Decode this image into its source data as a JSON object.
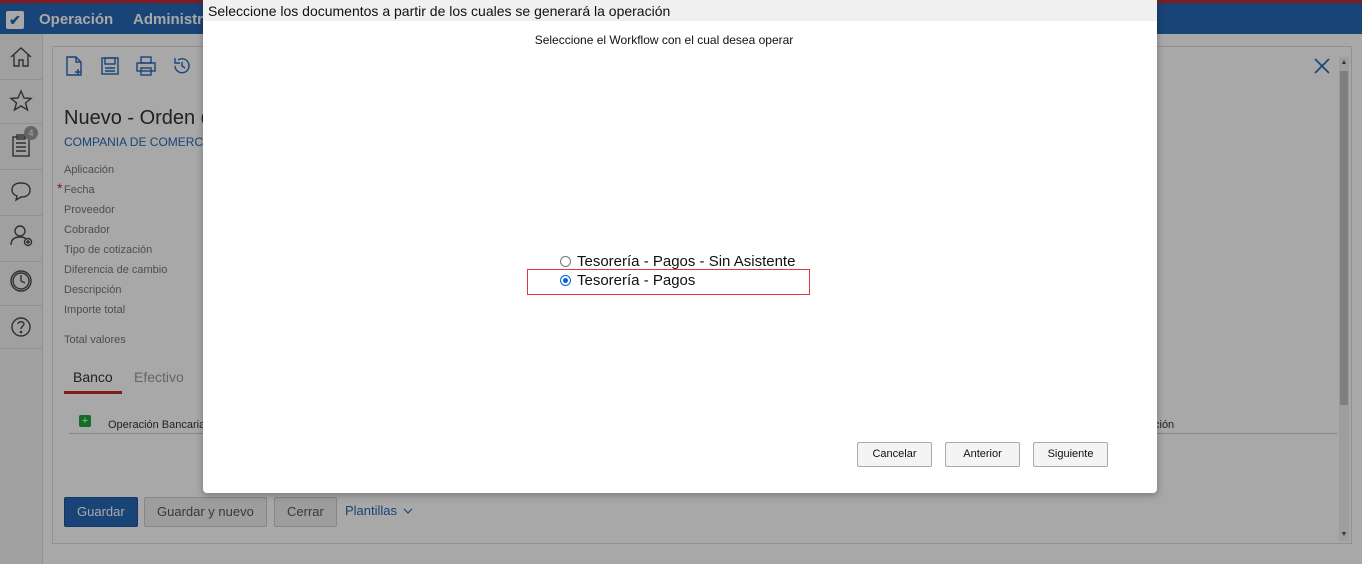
{
  "topbar": {
    "nav_items": [
      "Operación",
      "Administr"
    ]
  },
  "leftbar": {
    "badge_count": "4"
  },
  "form": {
    "title": "Nuevo - Orden d",
    "company": "COMPANIA DE COMERCIO",
    "required_mark": "*",
    "fields": [
      "Aplicación",
      "Fecha",
      "Proveedor",
      "Cobrador",
      "Tipo de cotización",
      "Diferencia de cambio",
      "Descripción",
      "Importe total",
      "Total valores"
    ],
    "tabs": [
      "Banco",
      "Efectivo"
    ],
    "grid_headers": [
      "Operación Bancaria",
      "ción"
    ],
    "add_symbol": "+",
    "buttons": {
      "save": "Guardar",
      "save_new": "Guardar y nuevo",
      "close": "Cerrar",
      "templates": "Plantillas"
    }
  },
  "modal": {
    "title": "Seleccione los documentos a partir de los cuales se generará la operación",
    "subtitle": "Seleccione el Workflow con el cual desea operar",
    "options": [
      {
        "label": "Tesorería - Pagos - Sin Asistente",
        "checked": false
      },
      {
        "label": "Tesorería - Pagos",
        "checked": true
      }
    ],
    "buttons": {
      "cancel": "Cancelar",
      "previous": "Anterior",
      "next": "Siguiente"
    }
  },
  "colors": {
    "brand_blue": "#2668b5",
    "accent_red": "#c6282d",
    "highlight_red": "#e23a3a"
  }
}
